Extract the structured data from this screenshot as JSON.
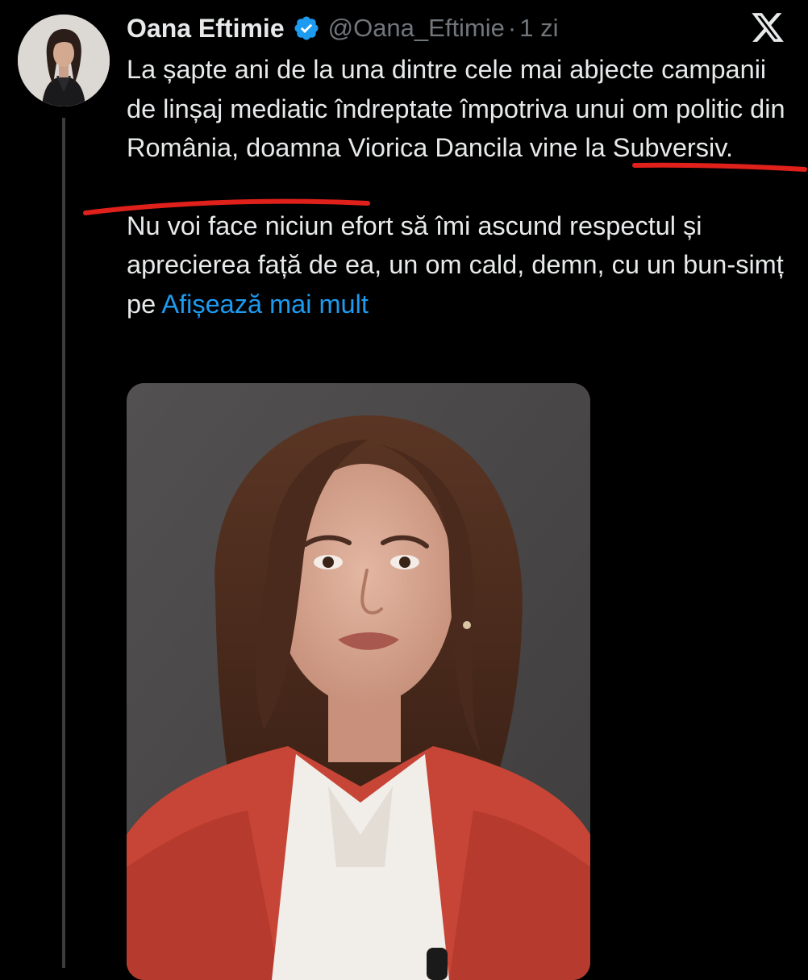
{
  "tweet": {
    "author_name": "Oana Eftimie",
    "handle": "@Oana_Eftimie",
    "separator": "·",
    "timestamp": "1 zi",
    "paragraph1": "La șapte ani de la una dintre cele mai abjecte campanii de linșaj mediatic îndreptate împotriva unui om politic din România, doamna Viorica Dancila vine la Subversiv.",
    "paragraph2": "Nu voi face niciun efort să îmi ascund respectul și aprecierea față de ea, un om cald, demn, cu un bun-simț pe ",
    "show_more": "Afișează mai mult"
  },
  "icons": {
    "verified": "verified-badge-icon",
    "platform_logo": "x-logo-icon"
  },
  "colors": {
    "background": "#000000",
    "text": "#e7e9ea",
    "secondary_text": "#71767b",
    "link": "#1d9bf0",
    "verified_badge": "#1d9bf0",
    "annotation_marker": "#e0201b"
  }
}
